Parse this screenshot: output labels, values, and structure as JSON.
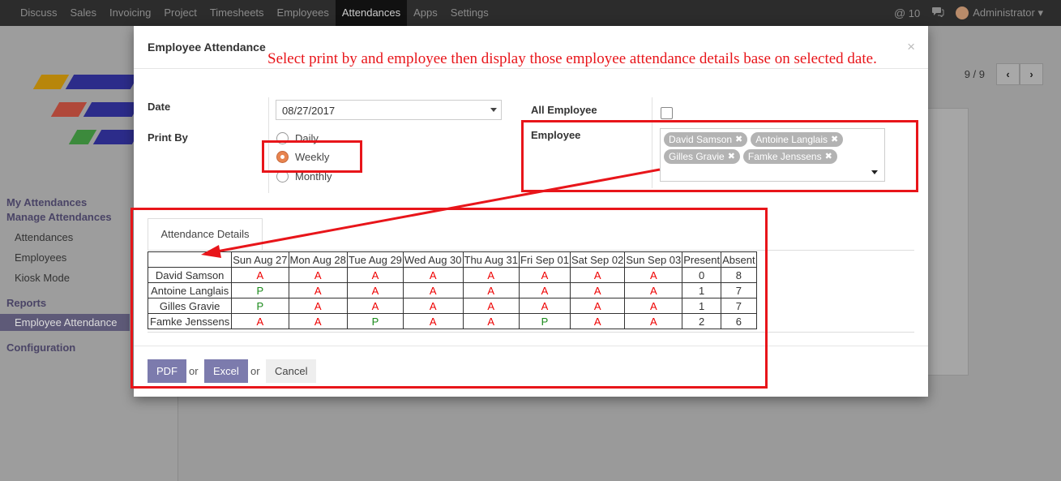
{
  "topnav": {
    "items": [
      "Discuss",
      "Sales",
      "Invoicing",
      "Project",
      "Timesheets",
      "Employees",
      "Attendances",
      "Apps",
      "Settings"
    ],
    "active_index": 6,
    "mentions_count": "10",
    "user": "Administrator"
  },
  "sidebar": {
    "my_attendances": "My Attendances",
    "manage_attendances": "Manage Attendances",
    "items": [
      "Attendances",
      "Employees",
      "Kiosk Mode"
    ],
    "reports": "Reports",
    "report_item": "Employee Attendance",
    "configuration": "Configuration"
  },
  "pager": {
    "text": "9 / 9"
  },
  "modal": {
    "title": "Employee Attendance",
    "close": "×",
    "annotation": "Select print by and employee then display those employee attendance details base on selected date.",
    "date_label": "Date",
    "date_value": "08/27/2017",
    "print_by_label": "Print By",
    "print_options": [
      "Daily",
      "Weekly",
      "Monthly"
    ],
    "selected_print": "Weekly",
    "all_employee_label": "All Employee",
    "all_employee_checked": false,
    "employee_label": "Employee",
    "employees": [
      "David Samson",
      "Antoine Langlais",
      "Gilles Gravie",
      "Famke Jenssens"
    ],
    "tab_label": "Attendance Details",
    "table": {
      "headers": [
        "",
        "Sun Aug 27",
        "Mon Aug 28",
        "Tue Aug 29",
        "Wed Aug 30",
        "Thu Aug 31",
        "Fri Sep 01",
        "Sat Sep 02",
        "Sun Sep 03",
        "Present",
        "Absent"
      ],
      "rows": [
        {
          "name": "David Samson",
          "days": [
            "A",
            "A",
            "A",
            "A",
            "A",
            "A",
            "A",
            "A"
          ],
          "present": "0",
          "absent": "8"
        },
        {
          "name": "Antoine Langlais",
          "days": [
            "P",
            "A",
            "A",
            "A",
            "A",
            "A",
            "A",
            "A"
          ],
          "present": "1",
          "absent": "7"
        },
        {
          "name": "Gilles Gravie",
          "days": [
            "P",
            "A",
            "A",
            "A",
            "A",
            "A",
            "A",
            "A"
          ],
          "present": "1",
          "absent": "7"
        },
        {
          "name": "Famke Jenssens",
          "days": [
            "A",
            "A",
            "P",
            "A",
            "A",
            "P",
            "A",
            "A"
          ],
          "present": "2",
          "absent": "6"
        }
      ]
    },
    "buttons": {
      "pdf": "PDF",
      "or1": "or",
      "excel": "Excel",
      "or2": "or",
      "cancel": "Cancel"
    }
  },
  "colors": {
    "annotation_red": "#e8151a",
    "primary_button": "#7c7bad",
    "present_green": "#1a8a1a",
    "absent_red": "#e00000"
  }
}
